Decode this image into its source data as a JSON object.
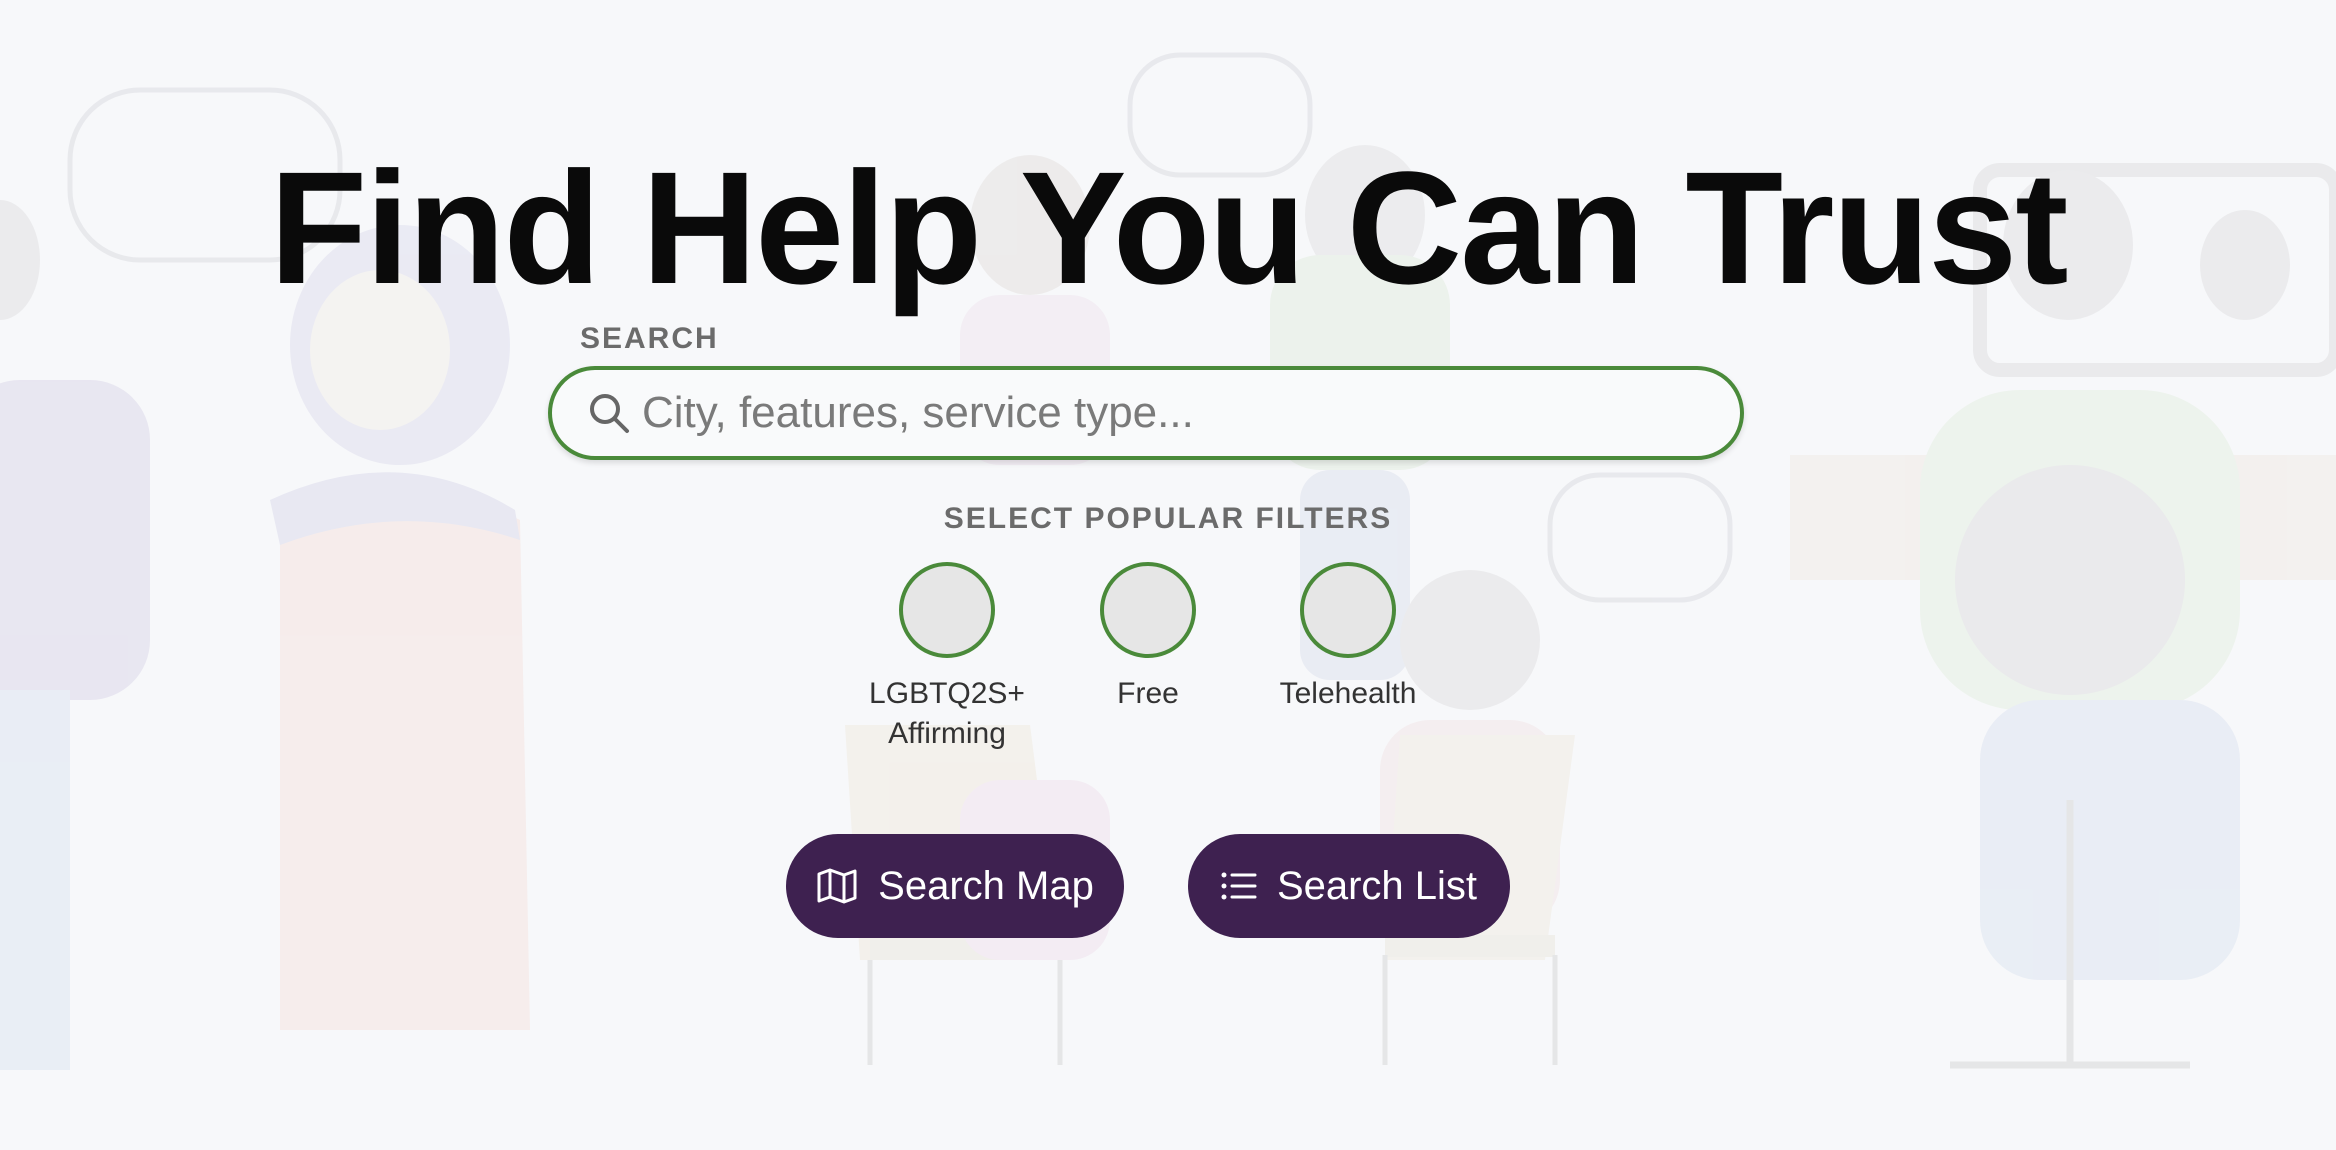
{
  "hero": {
    "headline": "Find Help You Can Trust"
  },
  "search": {
    "label": "SEARCH",
    "placeholder": "City, features, service type...",
    "value": "",
    "icon": "search-icon"
  },
  "filters": {
    "title": "SELECT POPULAR FILTERS",
    "items": [
      {
        "label": "LGBTQ2S+ Affirming",
        "selected": false
      },
      {
        "label": "Free",
        "selected": false
      },
      {
        "label": "Telehealth",
        "selected": false
      }
    ]
  },
  "actions": {
    "map_label": "Search Map",
    "map_icon": "map-icon",
    "list_label": "Search List",
    "list_icon": "list-icon"
  },
  "colors": {
    "accent_green": "#4a8a3a",
    "button_purple": "#3e2150",
    "background": "#f7f8fa"
  }
}
